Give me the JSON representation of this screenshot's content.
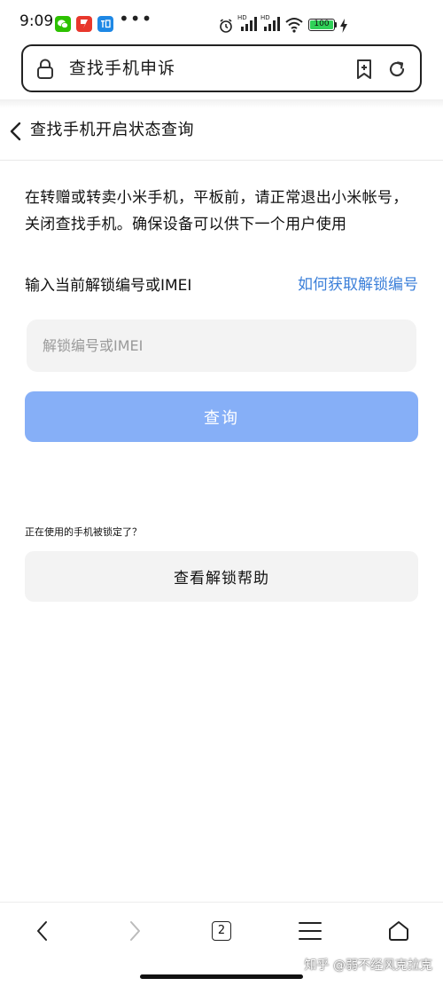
{
  "status_bar": {
    "time": "9:09",
    "dots": "•••",
    "signal_label_1": "HD",
    "signal_label_2": "HD",
    "battery_level": "100",
    "colors": {
      "wechat": "#2dc100",
      "app_red": "#e8372c",
      "zhihu": "#1e88e5",
      "battery": "#2fd158"
    },
    "icons": [
      "wechat-icon",
      "app-red-icon",
      "zhihu-icon",
      "alarm-icon",
      "signal-icon",
      "wifi-icon",
      "battery-icon",
      "charging-icon"
    ]
  },
  "address_bar": {
    "url_text": "查找手机申诉",
    "icons": [
      "lock-icon",
      "bookmark-add-icon",
      "refresh-icon"
    ]
  },
  "header": {
    "title": "查找手机开启状态查询"
  },
  "main": {
    "intro": "在转赠或转卖小米手机，平板前，请正常退出小米帐号，关闭查找手机。确保设备可以供下一个用户使用",
    "field_label": "输入当前解锁编号或IMEI",
    "help_link": "如何获取解锁编号",
    "input_placeholder": "解锁编号或IMEI",
    "input_value": "",
    "query_button": "查询",
    "locked_question": "正在使用的手机被锁定了？",
    "help_button": "查看解锁帮助",
    "colors": {
      "primary_button": "#86aff7",
      "link": "#3b7fd9",
      "secondary_button": "#f3f3f3"
    }
  },
  "bottom_nav": {
    "tab_count": "2",
    "icons": [
      "back-icon",
      "forward-icon",
      "tabs-icon",
      "menu-icon",
      "home-icon"
    ]
  },
  "watermark": "知乎 @弱不经风克拉克"
}
